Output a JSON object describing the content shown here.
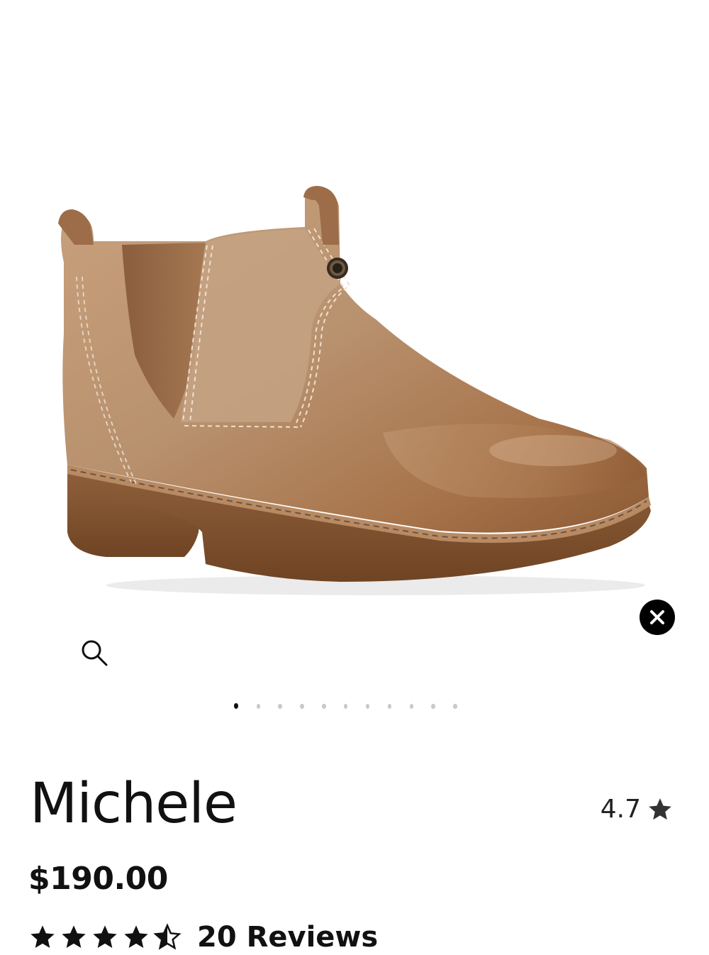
{
  "product": {
    "name": "Michele",
    "price": "$190.00",
    "rating": "4.7",
    "reviews_label": "20 Reviews",
    "star_rating": 4.5
  },
  "gallery": {
    "image_count": 11,
    "active_index": 0,
    "close_icon": "close-icon",
    "zoom_icon": "magnifier-icon"
  },
  "colors": {
    "leather": "#a87a55",
    "sole": "#8a5a36",
    "elastic": "#9a6e4c",
    "accent": "#000000"
  }
}
